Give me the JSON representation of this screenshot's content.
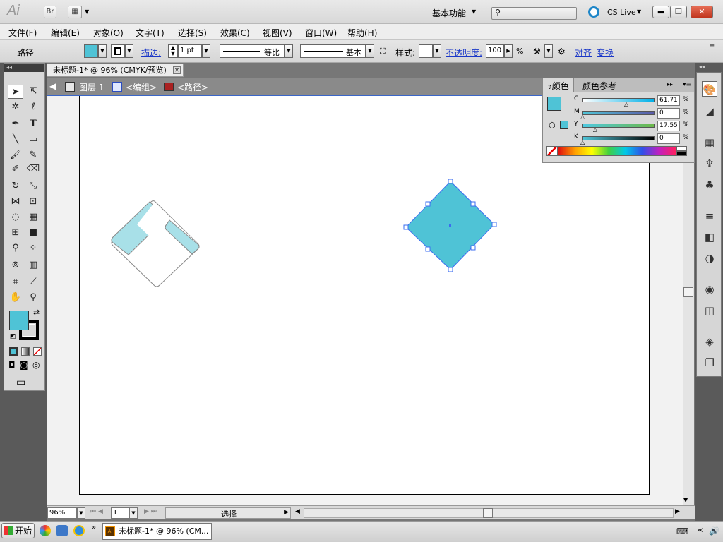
{
  "title_bar": {
    "app_logo": "Ai",
    "bridge_button": "Br",
    "workspace": "基本功能",
    "cslive": "CS Live",
    "window_buttons": {
      "minimize": "▬",
      "restore": "❐",
      "close": "✕"
    }
  },
  "menu": {
    "items": [
      "文件(F)",
      "编辑(E)",
      "对象(O)",
      "文字(T)",
      "选择(S)",
      "效果(C)",
      "视图(V)",
      "窗口(W)",
      "帮助(H)"
    ]
  },
  "control_bar": {
    "object_type": "路径",
    "stroke_label": "描边:",
    "stroke_weight": "1 pt",
    "profile": "等比",
    "brush": "基本",
    "style_label": "样式:",
    "opacity_label": "不透明度:",
    "opacity_value": "100",
    "opacity_unit": "%",
    "align": "对齐",
    "transform": "变换",
    "fill_color": "#4fc3d6"
  },
  "document": {
    "tab_title": "未标题-1* @ 96% (CMYK/预览)",
    "tab_close": "✕"
  },
  "isolation_bar": {
    "layer": "图层 1",
    "group": "<编组>",
    "path": "<路径>"
  },
  "color_panel": {
    "tab_color": "颜色",
    "tab_guide": "颜色参考",
    "channels": [
      {
        "label": "C",
        "value": "61.71",
        "unit": "%"
      },
      {
        "label": "M",
        "value": "0",
        "unit": "%"
      },
      {
        "label": "Y",
        "value": "17.55",
        "unit": "%"
      },
      {
        "label": "K",
        "value": "0",
        "unit": "%"
      }
    ],
    "fill": "#4fc3d6"
  },
  "status_bar": {
    "zoom": "96%",
    "artboard": "1",
    "tool_status": "选择"
  },
  "taskbar": {
    "start": "开始",
    "task_item": "未标题-1* @ 96% (CM..."
  },
  "artwork": {
    "left_shape_fill": "#a8e0e8",
    "right_shape_fill": "#4fc3d6",
    "selection_color": "#3b6cf0"
  }
}
